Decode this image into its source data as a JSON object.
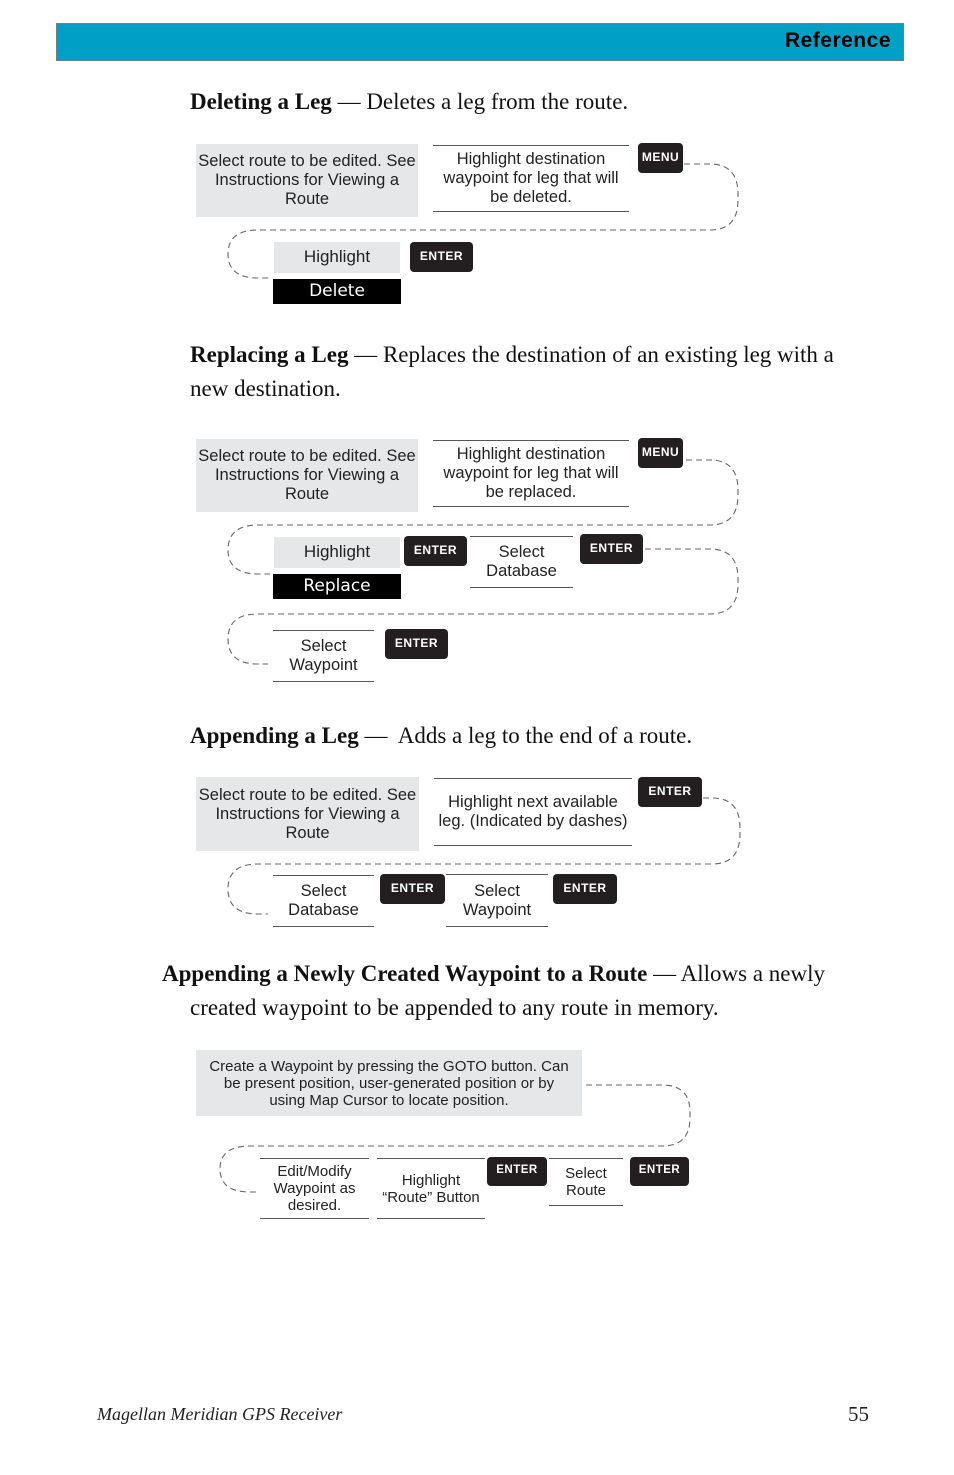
{
  "header": {
    "title": "Reference",
    "bar_color": "#00a0c6"
  },
  "sections": [
    {
      "title": "Deleting a Leg",
      "dash": " — ",
      "description": "Deletes a leg from the route.",
      "steps": {
        "select_route": "Select route to be edited. See Instructions for Viewing a Route",
        "highlight_dest": "Highlight destination waypoint for leg that will be deleted.",
        "menu_key": "MENU",
        "highlight_label": "Highlight",
        "option_label": "Delete",
        "enter_key": "ENTER"
      }
    },
    {
      "title": "Replacing a Leg",
      "dash": " — ",
      "description_line1": "Replaces the destination of an existing leg with a",
      "description_line2": "new destination.",
      "steps": {
        "select_route": "Select route to be edited. See Instructions for Viewing a Route",
        "highlight_dest": "Highlight destination waypoint for leg that will be replaced.",
        "menu_key": "MENU",
        "highlight_label": "Highlight",
        "option_label": "Replace",
        "enter_key_1": "ENTER",
        "select_database": "Select Database",
        "enter_key_2": "ENTER",
        "select_waypoint": "Select Waypoint",
        "enter_key_3": "ENTER"
      }
    },
    {
      "title": "Appending a Leg",
      "dash": " —  ",
      "description": "Adds a leg to the end of a route.",
      "steps": {
        "select_route": "Select route to be edited. See Instructions for Viewing a Route",
        "highlight_next": "Highlight next available leg.  (Indicated by dashes)",
        "enter_key_1": "ENTER",
        "select_database": "Select Database",
        "enter_key_2": "ENTER",
        "select_waypoint": "Select Waypoint",
        "enter_key_3": "ENTER"
      }
    },
    {
      "title": "Appending a Newly Created Waypoint to a Route",
      "dash": " — ",
      "description_line1": "Allows a newly",
      "description_line2": "created waypoint to be appended to any route in memory.",
      "steps": {
        "create_waypoint": "Create a Waypoint by pressing the GOTO button. Can be present position, user-generated position or by using Map Cursor to locate position.",
        "edit_modify": "Edit/Modify Waypoint as desired.",
        "highlight_route": "Highlight “Route” Button",
        "enter_key_1": "ENTER",
        "select_route": "Select Route",
        "enter_key_2": "ENTER"
      }
    }
  ],
  "footer": {
    "manual_title": "Magellan Meridian GPS Receiver",
    "page_number": "55"
  }
}
